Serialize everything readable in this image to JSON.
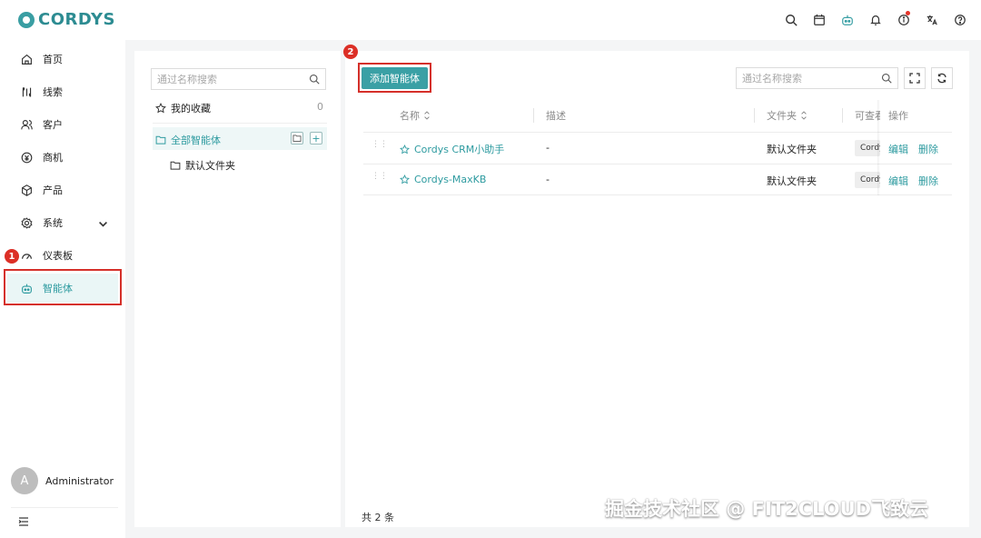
{
  "app": {
    "brand": "CORDYS"
  },
  "colors": {
    "accent": "#3aa0a5",
    "highlight": "#d5302a",
    "badge": "#dc2f26"
  },
  "topbar": {
    "icons": [
      "search-icon",
      "calendar-icon",
      "robot-icon",
      "bell-icon",
      "info-icon",
      "translate-icon",
      "help-icon"
    ]
  },
  "sidebar": {
    "items": [
      {
        "label": "首页",
        "icon": "home-icon"
      },
      {
        "label": "线索",
        "icon": "clue-icon"
      },
      {
        "label": "客户",
        "icon": "customer-icon"
      },
      {
        "label": "商机",
        "icon": "opportunity-icon"
      },
      {
        "label": "产品",
        "icon": "product-icon"
      },
      {
        "label": "系统",
        "icon": "system-icon"
      },
      {
        "label": "仪表板",
        "icon": "dashboard-icon"
      },
      {
        "label": "智能体",
        "icon": "agent-icon"
      }
    ],
    "user": {
      "avatar_letter": "A",
      "name": "Administrator"
    }
  },
  "badges": {
    "step1": "1",
    "step2": "2"
  },
  "left_panel": {
    "search_placeholder": "通过名称搜索",
    "favorites_label": "我的收藏",
    "favorites_count": "0",
    "all_agents_label": "全部智能体",
    "default_folder_label": "默认文件夹",
    "add_label": "+"
  },
  "main": {
    "add_button": "添加智能体",
    "search_placeholder": "通过名称搜索",
    "columns": {
      "name": "名称",
      "desc": "描述",
      "folder": "文件夹",
      "visible": "可查看",
      "actions": "操作"
    },
    "rows": [
      {
        "name": "Cordys CRM小助手",
        "desc": "-",
        "folder": "默认文件夹",
        "tag": "Cordys",
        "edit": "编辑",
        "delete": "删除"
      },
      {
        "name": "Cordys-MaxKB",
        "desc": "-",
        "folder": "默认文件夹",
        "tag": "Cordys",
        "edit": "编辑",
        "delete": "删除"
      }
    ],
    "total": "共 2 条"
  },
  "watermark": "掘金技术社区 @ FIT2CLOUD飞致云"
}
